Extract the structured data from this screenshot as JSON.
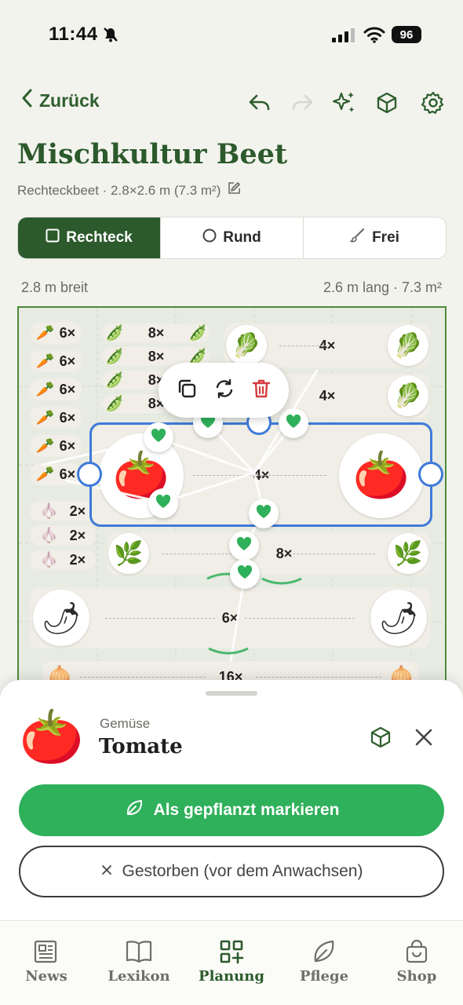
{
  "status_bar": {
    "time": "11:44",
    "battery": "96"
  },
  "header": {
    "back_label": "Zurück"
  },
  "bed": {
    "title": "Mischkultur Beet",
    "subtitle": "Rechteckbeet · 2.8×2.6 m (7.3 m²)",
    "width_label": "2.8 m breit",
    "length_label": "2.6 m lang · 7.3 m²"
  },
  "shape_tabs": [
    {
      "label": "Rechteck",
      "icon": "square-icon",
      "active": true
    },
    {
      "label": "Rund",
      "icon": "circle-icon",
      "active": false
    },
    {
      "label": "Frei",
      "icon": "brush-icon",
      "active": false
    }
  ],
  "plants": {
    "carrot_rows": [
      "6×",
      "6×",
      "6×",
      "6×",
      "6×",
      "6×"
    ],
    "bean_rows": [
      "8×",
      "8×",
      "8×",
      "8×"
    ],
    "chard_rows": [
      "4×",
      "4×"
    ],
    "tomato_row": "4×",
    "garlic_rows": [
      "2×",
      "2×",
      "2×"
    ],
    "basil_row": "8×",
    "pepper_row": "6×",
    "leek_row": "16×"
  },
  "sheet": {
    "category": "Gemüse",
    "name": "Tomate",
    "primary_action": "Als gepflanzt markieren",
    "secondary_action": "Gestorben (vor dem Anwachsen)"
  },
  "tabbar": [
    {
      "label": "News",
      "icon": "newspaper-icon",
      "active": false
    },
    {
      "label": "Lexikon",
      "icon": "book-icon",
      "active": false
    },
    {
      "label": "Planung",
      "icon": "grid-plus-icon",
      "active": true
    },
    {
      "label": "Pflege",
      "icon": "leaf-icon",
      "active": false
    },
    {
      "label": "Shop",
      "icon": "bag-icon",
      "active": false
    }
  ],
  "colors": {
    "accent": "#2c5a2c",
    "primary_button": "#2fb05a",
    "selection": "#3f7ad9",
    "heart": "#2fb05a"
  }
}
